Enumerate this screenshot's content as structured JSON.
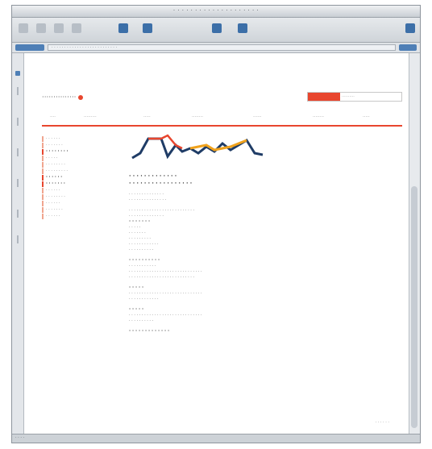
{
  "window": {
    "title": "· · · ·  · · · · · · · · ·  · · · · · · ·"
  },
  "addressbar": {
    "url": "· · · · · · · · · · · · · · · · · · · · · · · · · ·"
  },
  "site": {
    "logo_text": "···············",
    "search_placeholder": "··········",
    "nav_items": [
      "····",
      "·········",
      "·····",
      "········",
      "······",
      "········",
      "·····"
    ]
  },
  "leftnav": {
    "items": [
      {
        "label": "· · · · · ·",
        "bold": false
      },
      {
        "label": "· · · · · · ·",
        "bold": false
      },
      {
        "label": "· · · · · · · ·",
        "bold": true
      },
      {
        "label": "· · · · ·",
        "bold": false
      },
      {
        "label": "· · · · · · · ·",
        "bold": false
      },
      {
        "label": "· · · · · · · · ·",
        "bold": false
      },
      {
        "label": "· · · · · ·",
        "bold": true
      },
      {
        "label": "· · · · · · ·",
        "bold": true
      },
      {
        "label": "· · · · · ·",
        "bold": false
      },
      {
        "label": "· · · · · · · ·",
        "bold": false
      },
      {
        "label": "· · · · · ·",
        "bold": false
      },
      {
        "label": "· · · · · · ·",
        "bold": false
      },
      {
        "label": "· · · · · ·",
        "bold": false
      }
    ]
  },
  "article": {
    "heading_1": "· · · · · · ·  · · · · · ·",
    "heading_2": "· · · · · · · · · · ·  · · · · · ·",
    "body": [
      "· · · · · · · · · · · · · ·",
      "· · · · · · · · · · · · · · ·",
      "",
      "· · · · · · · · · · · · · · · · · · · · · · · · · ·",
      "· · · · · · · · · · · · · ·",
      "· · · · · · ·",
      "· · · · ·",
      "· · · · · · ·",
      "· · · · · · · · ·",
      "· · · · · · · · · · · ·",
      "· · · · · · · · · ·",
      "",
      "· · · · · · · · · ·",
      "· · · · · · · · · · ·",
      "· · · · · · · · · · · · · · · · · · · · · · · · · · · · ·",
      "· · · · · · · · · · · · · · · · · · · · · · · · · ·",
      "",
      "· · · · ·",
      "· · · · · · · · · · · · · · · · · · · · · · · · · · · · ·",
      "· · · · · · · · · · · ·",
      "",
      "· · · · ·",
      "· · · · · · · · · · · · · · · · · · · · · · · · · · · · ·",
      "· · · · · · · · · ·",
      "",
      "· · · · · · · · ·  · · · ·"
    ],
    "page_link": "· · · · · ·"
  },
  "statusbar": {
    "text": "· · · ·"
  },
  "colors": {
    "brand_red": "#e8462e",
    "accent_blue": "#3c6fa8",
    "chart_orange": "#f0a21c",
    "chart_navy": "#1f3c66"
  },
  "icons": [
    "back-icon",
    "forward-icon",
    "stop-icon",
    "reload-icon",
    "home-icon",
    "bookmark-icon",
    "print-icon",
    "mail-icon"
  ]
}
